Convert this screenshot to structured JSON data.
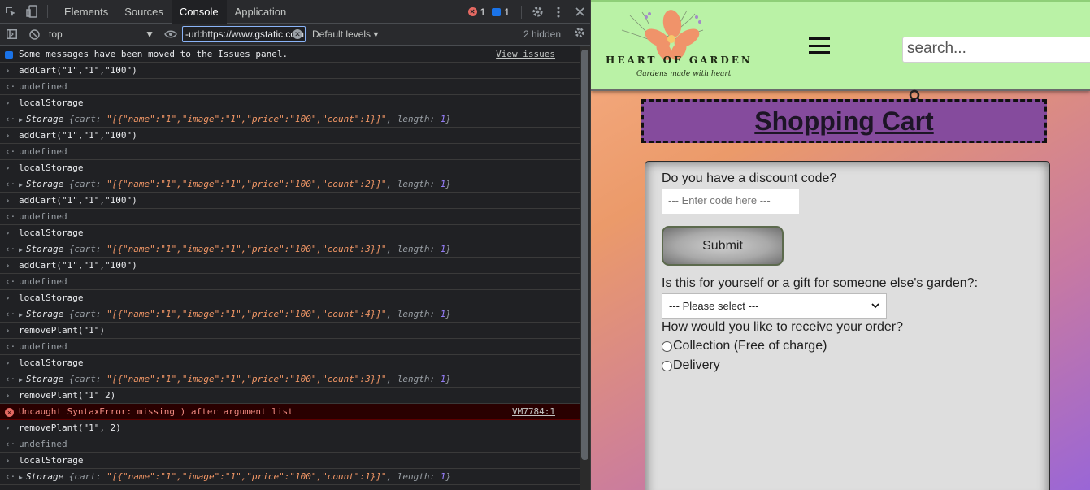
{
  "devtools": {
    "tabs": [
      "Elements",
      "Sources",
      "Console",
      "Application"
    ],
    "active_tab": "Console",
    "error_count": "1",
    "issue_count": "1",
    "context": "top",
    "filter_value": "-url:https://www.gstatic.com",
    "levels": "Default levels",
    "hidden": "2 hidden",
    "info_message": "Some messages have been moved to the Issues panel.",
    "view_issues": "View issues",
    "error_message": "Uncaught SyntaxError: missing ) after argument list",
    "error_source": "VM7784:1",
    "undefined": "undefined",
    "local_storage": "localStorage",
    "cmd_add": "addCart(\"1\",\"1\",\"100\")",
    "cmd_remove1": "removePlant(\"1\")",
    "cmd_remove_bad": "removePlant(\"1\" 2)",
    "cmd_remove2": "removePlant(\"1\", 2)",
    "storage_label": "Storage",
    "storage_counts": [
      "1",
      "2",
      "3",
      "4",
      "3",
      "1"
    ]
  },
  "site": {
    "logo_text": "HEART OF GARDEN",
    "logo_sub": "Gardens made with heart",
    "search_placeholder": "search...",
    "cart_title": "Shopping Cart",
    "discount_question": "Do you have a discount code?",
    "discount_placeholder": "--- Enter code here ---",
    "submit_label": "Submit",
    "gift_question": "Is this for yourself or a gift for someone else's garden?:",
    "gift_selected": "--- Please select ---",
    "receive_question": "How would you like to receive your order?",
    "option_collection": "Collection (Free of charge)",
    "option_delivery": "Delivery"
  }
}
